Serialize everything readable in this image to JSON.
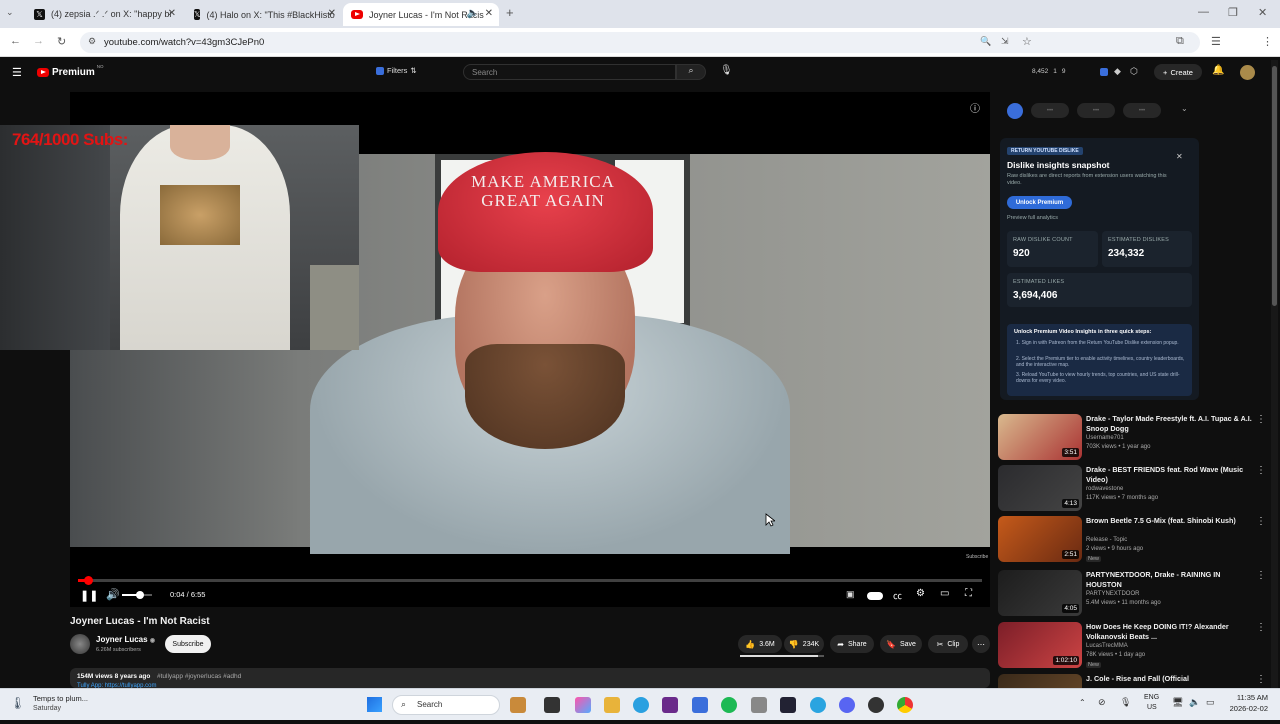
{
  "browser": {
    "tabs": [
      {
        "label": "(4) zepsia .ᐟ .ᐟ on X: \"happy bi",
        "icon": "x-logo-icon"
      },
      {
        "label": "(4) Halo on X: \"This #BlackHisto",
        "icon": "x-logo-icon"
      },
      {
        "label": "Joyner Lucas - I'm Not Racis",
        "icon": "youtube-icon"
      }
    ],
    "new_tab": "+",
    "url": "youtube.com/watch?v=43gm3CJePn0"
  },
  "youtube": {
    "logo": "Premium",
    "logo_badge": "NO",
    "filters_label": "Filters",
    "search_placeholder": "Search",
    "header_stats": {
      "a": "8,452",
      "b": "1",
      "c": "9"
    },
    "create_label": "Create"
  },
  "player": {
    "overlay_text": "764/1000  Subs:",
    "cap_text": "MAKE AMERICA GREAT AGAIN",
    "time": "0:04 / 6:55",
    "progress": 0.01,
    "volume": 0.6,
    "watermark": "Subscribe"
  },
  "video": {
    "title": "Joyner Lucas - I'm Not Racist",
    "channel": "Joyner Lucas",
    "subscribers": "6.26M subscribers",
    "subscribe_label": "Subscribe",
    "likes": "3.6M",
    "dislikes": "234K",
    "share_label": "Share",
    "save_label": "Save",
    "clip_label": "Clip",
    "views_line": "154M views  8 years ago",
    "hashtags": "#tullyapp #joynerlucas #adhd",
    "desc_line": "Tully App: https://tullyapp.com"
  },
  "extension": {
    "chips": [
      "•••",
      "•••",
      "•••"
    ],
    "badge": "RETURN YOUTUBE DISLIKE",
    "title": "Dislike insights snapshot",
    "subtitle": "Raw dislikes are direct reports from extension users watching this video.",
    "unlock_button": "Unlock Premium",
    "preview": "Preview full analytics",
    "raw_label": "RAW DISLIKE COUNT",
    "raw_value": "920",
    "est_dislikes_label": "ESTIMATED DISLIKES",
    "est_dislikes_value": "234,332",
    "est_likes_label": "ESTIMATED LIKES",
    "est_likes_value": "3,694,406",
    "steps_title": "Unlock Premium Video Insights in three quick steps:",
    "steps": [
      "Sign in with Patreon from the Return YouTube Dislike extension popup.",
      "Select the Premium tier to enable activity timelines, country leaderboards, and the interactive map.",
      "Reload YouTube to view hourly trends, top countries, and US state drill-downs for every video."
    ]
  },
  "recommendations": [
    {
      "title": "Drake - Taylor Made Freestyle ft. A.I. Tupac & A.I. Snoop Dogg",
      "channel": "Username701",
      "meta": "703K views • 1 year ago",
      "duration": "3:51",
      "new": "",
      "colors": [
        "#d9b98e",
        "#a33"
      ]
    },
    {
      "title": "Drake - BEST FRIENDS feat. Rod Wave (Music Video)",
      "channel": "rodwavestone",
      "meta": "117K views • 7 months ago",
      "duration": "4:13",
      "new": "",
      "colors": [
        "#2b2b2e",
        "#444"
      ]
    },
    {
      "title": "Brown Beetle 7.5 G-Mix (feat. Shinobi Kush)",
      "channel": "Release - Topic",
      "meta": "2 views • 9 hours ago",
      "duration": "2:51",
      "new": "New",
      "colors": [
        "#c55a1a",
        "#6a2a12"
      ]
    },
    {
      "title": "PARTYNEXTDOOR, Drake - RAINING IN HOUSTON",
      "channel": "PARTYNEXTDOOR",
      "meta": "5.4M views • 11 months ago",
      "duration": "4:05",
      "new": "",
      "colors": [
        "#1d1d1d",
        "#3a3a3a"
      ]
    },
    {
      "title": "How Does He Keep DOING IT!? Alexander Volkanovski Beats ...",
      "channel": "LucasTrecMMA",
      "meta": "78K views • 1 day ago",
      "duration": "1:02:10",
      "new": "New",
      "colors": [
        "#7c1e28",
        "#c44"
      ]
    },
    {
      "title": "J. Cole - Rise and Fall (Official",
      "channel": "",
      "meta": "",
      "duration": "",
      "new": "",
      "colors": [
        "#3a2a1a",
        "#6a4a2a"
      ]
    }
  ],
  "taskbar": {
    "weather": "Temps to plum...",
    "weather_sub": "Saturday",
    "search": "Search",
    "lang": "ENG",
    "region": "US",
    "time": "11:35 AM",
    "date": "2026-02-02"
  }
}
